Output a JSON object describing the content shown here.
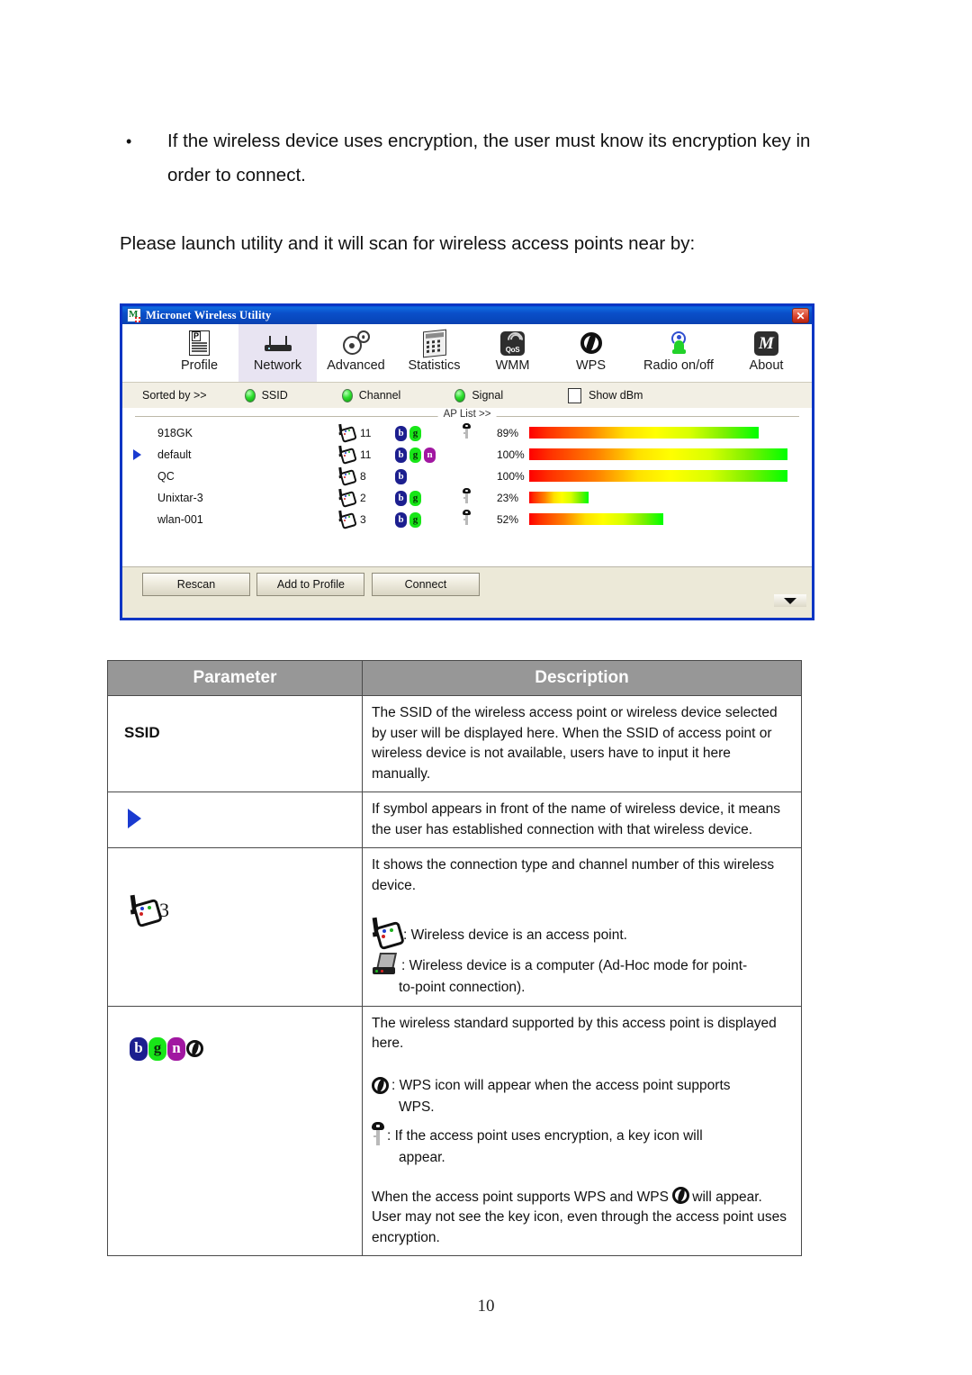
{
  "document": {
    "bullet_text": "If the wireless device uses encryption, the user must know its encryption key in order to connect.",
    "bullet_marker": "•",
    "paragraph": "Please launch utility and it will scan for wireless access points near by:",
    "page_number": "10"
  },
  "window": {
    "title": "Micronet Wireless Utility",
    "close_label": "✕",
    "logo_letter": "M",
    "toolbar": [
      {
        "label": "Profile",
        "icon": "document-profile-icon",
        "active": false
      },
      {
        "label": "Network",
        "icon": "router-icon",
        "active": true
      },
      {
        "label": "Advanced",
        "icon": "gears-icon",
        "active": false
      },
      {
        "label": "Statistics",
        "icon": "calculator-icon",
        "active": false
      },
      {
        "label": "WMM",
        "icon": "qos-signal-icon",
        "active": false
      },
      {
        "label": "WPS",
        "icon": "wps-icon",
        "active": false
      },
      {
        "label": "Radio on/off",
        "icon": "radio-antenna-icon",
        "active": false
      },
      {
        "label": "About",
        "icon": "micronet-m-icon",
        "active": false
      }
    ],
    "sortbar": {
      "label": "Sorted by >>",
      "options": [
        "SSID",
        "Channel",
        "Signal"
      ],
      "show_dbm_label": "Show dBm",
      "show_dbm_checked": false
    },
    "aplist": {
      "caption": "AP List >>",
      "rows": [
        {
          "ssid": "918GK",
          "connected": false,
          "channel": "11",
          "standards": [
            "b",
            "g"
          ],
          "encrypted": true,
          "signal_label": "89%",
          "signal_pct": 89
        },
        {
          "ssid": "default",
          "connected": true,
          "channel": "11",
          "standards": [
            "b",
            "g",
            "n"
          ],
          "encrypted": false,
          "signal_label": "100%",
          "signal_pct": 100
        },
        {
          "ssid": "QC",
          "connected": false,
          "channel": "8",
          "standards": [
            "b"
          ],
          "encrypted": false,
          "signal_label": "100%",
          "signal_pct": 100
        },
        {
          "ssid": "Unixtar-3",
          "connected": false,
          "channel": "2",
          "standards": [
            "b",
            "g"
          ],
          "encrypted": true,
          "signal_label": "23%",
          "signal_pct": 23
        },
        {
          "ssid": "wlan-001",
          "connected": false,
          "channel": "3",
          "standards": [
            "b",
            "g"
          ],
          "encrypted": true,
          "signal_label": "52%",
          "signal_pct": 52
        }
      ]
    },
    "buttons": [
      {
        "label": "Rescan"
      },
      {
        "label": "Add to Profile"
      },
      {
        "label": "Connect"
      }
    ],
    "scroll_down_icon": "triangle-down-icon"
  },
  "table": {
    "headers": {
      "parameter": "Parameter",
      "description": "Description"
    },
    "rows": [
      {
        "param_label": "SSID",
        "param_icon": null,
        "desc": "The SSID of the wireless access point or wireless device selected by user will be displayed here. When the SSID of access point or wireless device is not available, users have to input it here manually."
      },
      {
        "param_label": null,
        "param_icon": "blue-triangle-icon",
        "desc": "If symbol appears in front of the name of wireless device, it means the user has established connection with that wireless device."
      },
      {
        "param_label": null,
        "param_icon": "access-point-channel-icon",
        "param_channel": "3",
        "desc": "It shows the connection type and channel number of this wireless device.",
        "notes": [
          {
            "icon": "access-point-icon",
            "text": ": Wireless device is an access point."
          },
          {
            "icon": "computer-adhoc-icon",
            "text": ": Wireless device is a computer (Ad-Hoc mode for point-",
            "indent": "to-point connection)."
          }
        ]
      },
      {
        "param_label": null,
        "param_icon": "bgn-wps-badges-icon",
        "param_badges": [
          "b",
          "g",
          "n"
        ],
        "desc": "The wireless standard supported by this access point is displayed here.",
        "notes": [
          {
            "icon": "wps-icon",
            "text": ": WPS icon will appear when the access point supports",
            "indent": "WPS."
          },
          {
            "icon": "key-icon",
            "text": ": If the access point uses encryption, a key icon will",
            "indent": "appear."
          }
        ],
        "footer_before": "When the access point supports WPS and WPS",
        "footer_icon": "wps-icon",
        "footer_after": "will appear. User may not see the key icon, even through the access point uses encryption."
      }
    ]
  },
  "colors": {
    "title_bar": "#0a4ec9",
    "active_tab": "#e8e4f2",
    "badge_b": "#1c1f8f",
    "badge_g": "#18e618",
    "badge_n": "#a117a1",
    "connected_arrow": "#1a3ad0",
    "table_header": "#979797",
    "signal_gradient_start": "#ff0000",
    "signal_gradient_mid": "#ffff00",
    "signal_gradient_end": "#00ff00"
  }
}
